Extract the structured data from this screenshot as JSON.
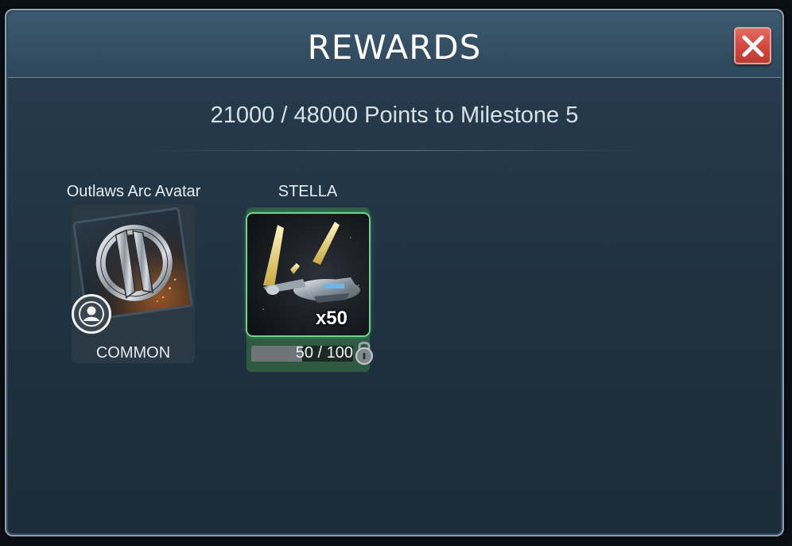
{
  "dialog": {
    "title": "REWARDS",
    "close_icon": "close-x-icon",
    "subtitle": "21000 / 48000 Points to Milestone 5"
  },
  "rewards": [
    {
      "name": "Outlaws Arc Avatar",
      "rarity": "COMMON",
      "icon": "outlaws-arc-emblem-icon",
      "badge_icon": "person-icon"
    },
    {
      "name": "STELLA",
      "quantity": "x50",
      "progress_text": "50 / 100",
      "progress": 0.5,
      "icon": "starship-icon",
      "status_icon": "lock-icon"
    }
  ],
  "colors": {
    "close_button": "#d2473c",
    "highlight_green": "#6bd58e"
  }
}
